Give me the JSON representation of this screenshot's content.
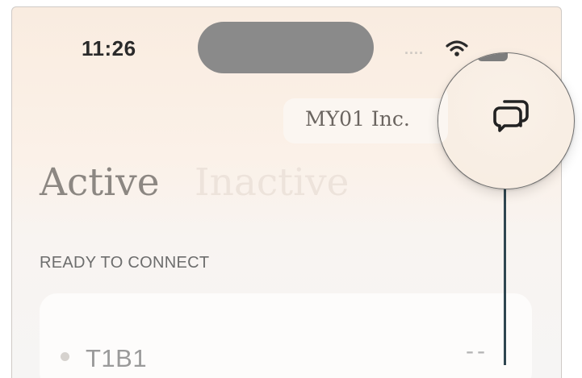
{
  "status_bar": {
    "time": "11:26",
    "signal": "....",
    "wifi_icon": "wifi-icon",
    "battery_icon": "battery-icon"
  },
  "header": {
    "company": "MY01 Inc.",
    "chat_icon": "chat-bubbles-icon"
  },
  "tabs": [
    {
      "label": "Active",
      "selected": true
    },
    {
      "label": "Inactive",
      "selected": false
    }
  ],
  "section": {
    "title": "READY TO CONNECT"
  },
  "devices": [
    {
      "name": "T1B1",
      "value": "--"
    }
  ],
  "colors": {
    "callout": "#2f4650",
    "background_top": "#f9ece0",
    "tab_active": "#8c8782",
    "tab_inactive": "#ede3db"
  }
}
